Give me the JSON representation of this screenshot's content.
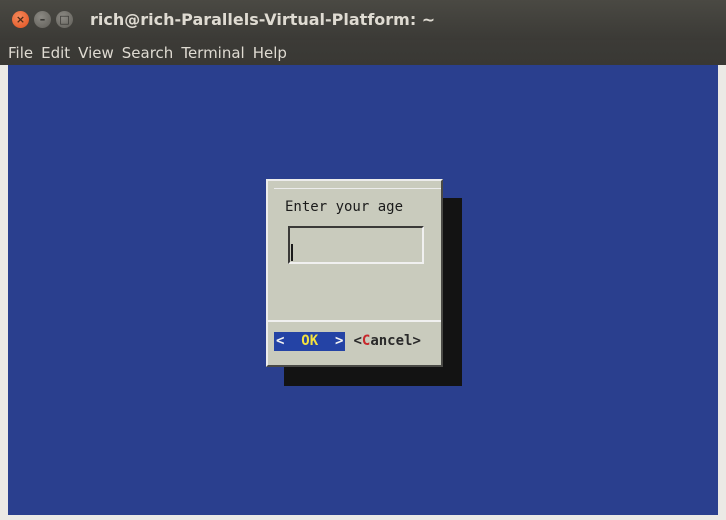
{
  "window": {
    "title": "rich@rich-Parallels-Virtual-Platform: ~",
    "close_glyph": "×",
    "minimize_glyph": "–",
    "maximize_glyph": "□"
  },
  "menu": {
    "items": [
      "File",
      "Edit",
      "View",
      "Search",
      "Terminal",
      "Help"
    ]
  },
  "dialog": {
    "prompt": "Enter your age",
    "input_value": "",
    "ok": {
      "left": "<  ",
      "hot": "OK",
      "right": "  >"
    },
    "cancel": {
      "left": "<",
      "hot": "C",
      "rest": "ancel>"
    }
  },
  "colors": {
    "terminal_bg": "#2a3f8e",
    "dialog_bg": "#c9cbbd",
    "ok_button_bg": "#2443a5",
    "ok_hotkey": "#f4e23f",
    "cancel_hotkey": "#c8262a",
    "titlebar_bg": "#3c3b37",
    "close_button": "#e0501f"
  }
}
